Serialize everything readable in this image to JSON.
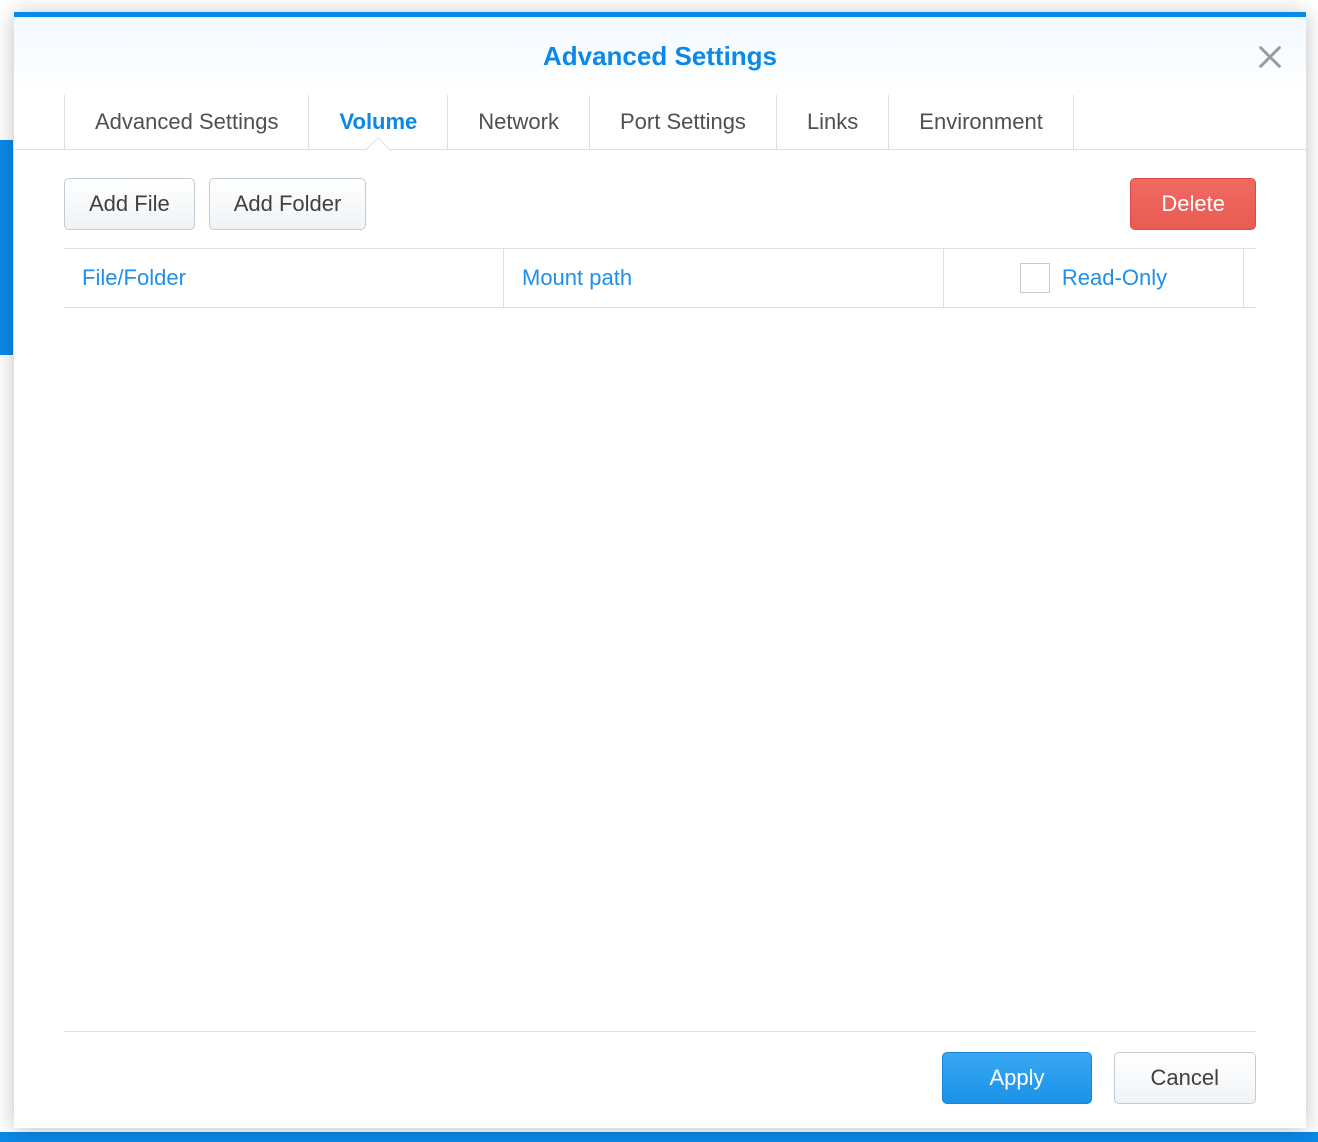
{
  "modal": {
    "title": "Advanced Settings"
  },
  "tabs": {
    "advanced": "Advanced Settings",
    "volume": "Volume",
    "network": "Network",
    "port": "Port Settings",
    "links": "Links",
    "environment": "Environment",
    "active": "volume"
  },
  "toolbar": {
    "add_file": "Add File",
    "add_folder": "Add Folder",
    "delete": "Delete"
  },
  "table": {
    "col_file": "File/Folder",
    "col_mount": "Mount path",
    "col_readonly": "Read-Only"
  },
  "footer": {
    "apply": "Apply",
    "cancel": "Cancel"
  }
}
